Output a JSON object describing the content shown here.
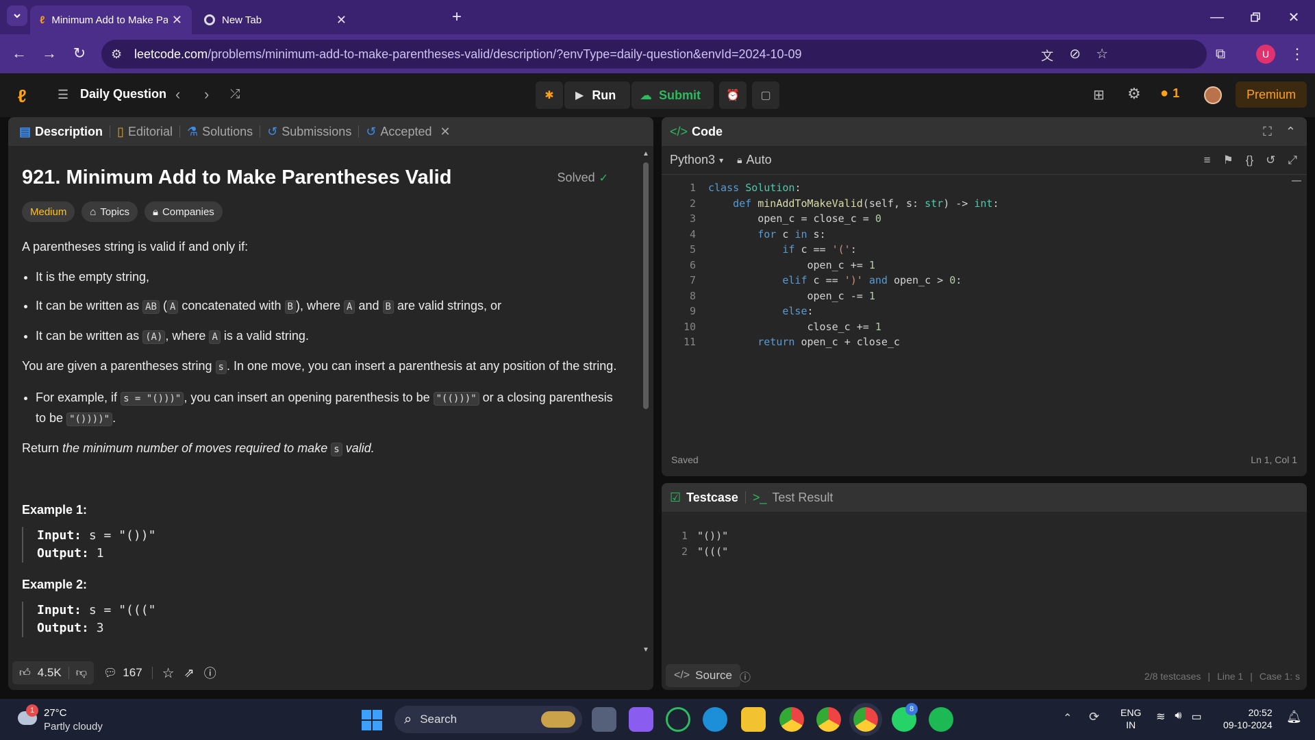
{
  "browser": {
    "tabs": [
      {
        "title": "Minimum Add to Make Parenth"
      },
      {
        "title": "New Tab"
      }
    ],
    "url_host": "leetcode.com",
    "url_rest": "/problems/minimum-add-to-make-parentheses-valid/description/?envType=daily-question&envId=2024-10-09",
    "profile_initial": "U"
  },
  "nav": {
    "title": "Daily Question",
    "run_label": "Run",
    "submit_label": "Submit",
    "streak": "1",
    "premium_label": "Premium"
  },
  "left_tabs": [
    "Description",
    "Editorial",
    "Solutions",
    "Submissions",
    "Accepted"
  ],
  "problem": {
    "title": "921. Minimum Add to Make Parentheses Valid",
    "status": "Solved",
    "difficulty": "Medium",
    "tags": [
      "Topics",
      "Companies"
    ],
    "intro": "A parentheses string is valid if and only if:",
    "b1": "It is the empty string,",
    "b2a": "It can be written as",
    "b2_code1": "AB",
    "b2b": "(",
    "b2_code2": "A",
    "b2c": "concatenated with",
    "b2_code3": "B",
    "b2d": "), where",
    "b2_code4": "A",
    "b2e": "and",
    "b2_code5": "B",
    "b2f": "are valid strings, or",
    "b3a": "It can be written as",
    "b3_code1": "(A)",
    "b3b": ", where",
    "b3_code2": "A",
    "b3c": "is a valid string.",
    "p2a": "You are given a parentheses string",
    "p2_code": "s",
    "p2b": ". In one move, you can insert a parenthesis at any position of the string.",
    "b4a": "For example, if",
    "b4_code1": "s = \"()))\"",
    "b4b": ", you can insert an opening parenthesis to be",
    "b4_code2": "\"(()))\"",
    "b4c": "or a closing parenthesis to be",
    "b4_code3": "\"())))\"",
    "b4d": ".",
    "p3a": "Return",
    "p3_em": "the minimum number of moves required to make",
    "p3_code": "s",
    "p3_em2": "valid.",
    "examples": [
      {
        "heading": "Example 1:",
        "input_label": "Input:",
        "input": "s = \"())\"",
        "output_label": "Output:",
        "output": "1"
      },
      {
        "heading": "Example 2:",
        "input_label": "Input:",
        "input": "s = \"(((\"",
        "output_label": "Output:",
        "output": "3"
      }
    ],
    "likes": "4.5K",
    "comments": "167"
  },
  "editor": {
    "title": "Code",
    "language": "Python3",
    "mode": "Auto",
    "saved": "Saved",
    "cursor": "Ln 1, Col 1",
    "lines": [
      {
        "n": "1",
        "t": "class Solution:"
      },
      {
        "n": "2",
        "t": "    def minAddToMakeValid(self, s: str) -> int:"
      },
      {
        "n": "3",
        "t": "        open_c = close_c = 0"
      },
      {
        "n": "4",
        "t": "        for c in s:"
      },
      {
        "n": "5",
        "t": "            if c == '(':"
      },
      {
        "n": "6",
        "t": "                open_c += 1"
      },
      {
        "n": "7",
        "t": "            elif c == ')' and open_c > 0:"
      },
      {
        "n": "8",
        "t": "                open_c -= 1"
      },
      {
        "n": "9",
        "t": "            else:"
      },
      {
        "n": "10",
        "t": "                close_c += 1"
      },
      {
        "n": "11",
        "t": "        return open_c + close_c"
      }
    ]
  },
  "testcase": {
    "tab1": "Testcase",
    "tab2": "Test Result",
    "lines": [
      {
        "n": "1",
        "t": "\"())\""
      },
      {
        "n": "2",
        "t": "\"(((\""
      }
    ],
    "source_label": "Source",
    "count": "2/8 testcases",
    "line": "Line 1",
    "case": "Case 1: s"
  },
  "taskbar": {
    "temp": "27°C",
    "weather": "Partly cloudy",
    "weather_badge": "1",
    "search": "Search",
    "lang1": "ENG",
    "lang2": "IN",
    "time": "20:52",
    "date": "09-10-2024",
    "whatsapp_badge": "8"
  }
}
